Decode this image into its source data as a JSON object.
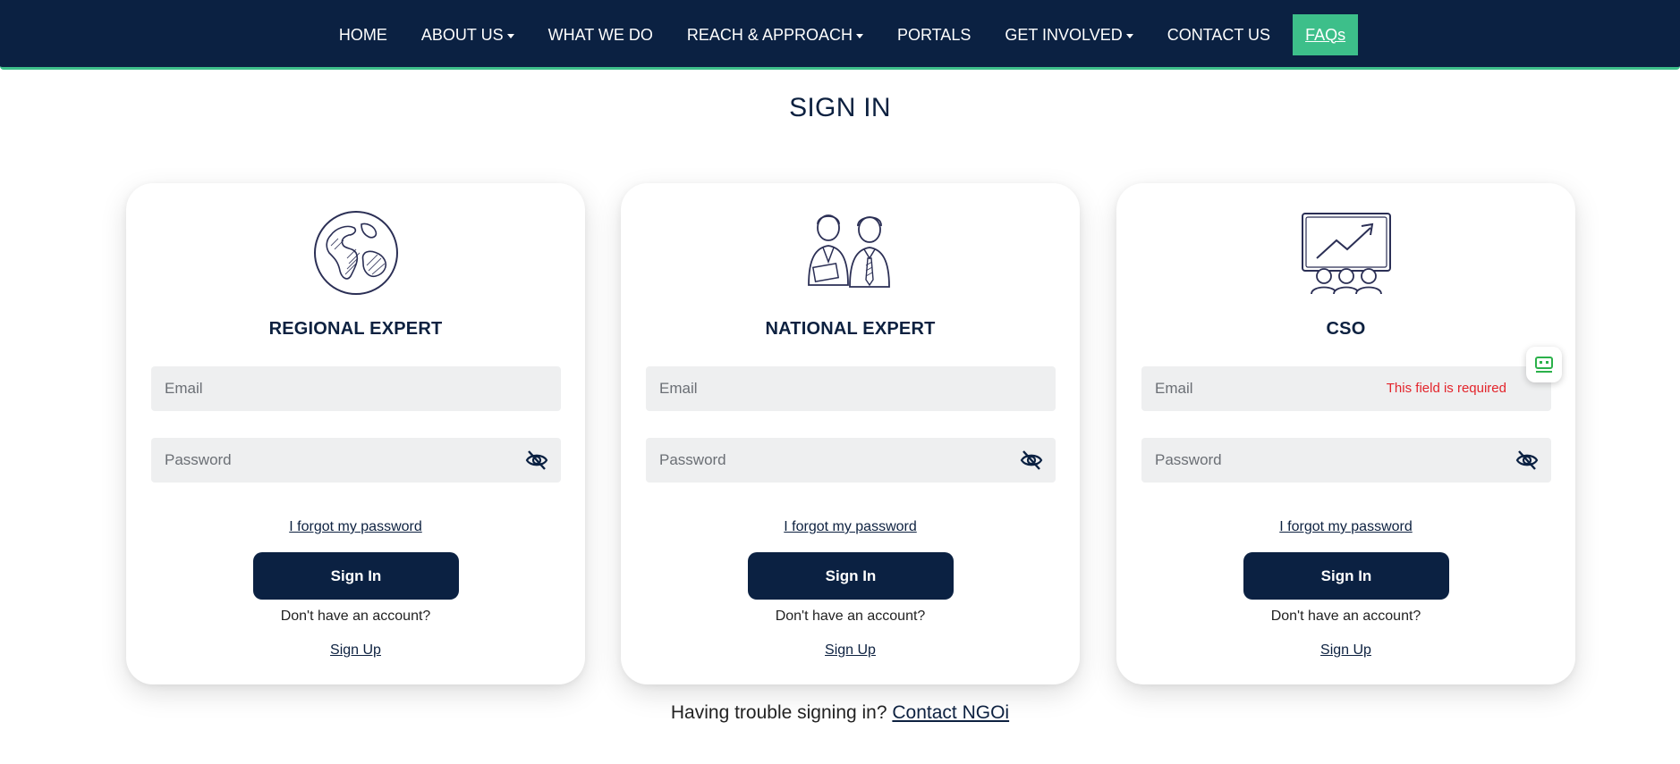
{
  "nav": {
    "items": [
      {
        "label": "HOME",
        "dropdown": false
      },
      {
        "label": "ABOUT US",
        "dropdown": true
      },
      {
        "label": "WHAT WE DO",
        "dropdown": false
      },
      {
        "label": "REACH & APPROACH",
        "dropdown": true
      },
      {
        "label": "PORTALS",
        "dropdown": false
      },
      {
        "label": "GET INVOLVED",
        "dropdown": true
      },
      {
        "label": "CONTACT US",
        "dropdown": false
      }
    ],
    "faq_label": "FAQs"
  },
  "page": {
    "title": "SIGN IN"
  },
  "cards": [
    {
      "title": "REGIONAL EXPERT",
      "icon": "globe-icon",
      "email_placeholder": "Email",
      "password_placeholder": "Password",
      "forgot": "I forgot my password",
      "signin": "Sign In",
      "no_account": "Don't have an account?",
      "signup": "Sign Up"
    },
    {
      "title": "NATIONAL EXPERT",
      "icon": "people-icon",
      "email_placeholder": "Email",
      "password_placeholder": "Password",
      "forgot": "I forgot my password",
      "signin": "Sign In",
      "no_account": "Don't have an account?",
      "signup": "Sign Up"
    },
    {
      "title": "CSO",
      "icon": "presentation-icon",
      "email_placeholder": "Email",
      "password_placeholder": "Password",
      "email_error": "This field is required",
      "forgot": "I forgot my password",
      "signin": "Sign In",
      "no_account": "Don't have an account?",
      "signup": "Sign Up"
    }
  ],
  "footer": {
    "trouble_text": "Having trouble signing in?",
    "contact_link": "Contact NGOi"
  },
  "colors": {
    "navy": "#0b2142",
    "accent": "#3dbf8a",
    "error": "#e3242b",
    "field_bg": "#eeeff0"
  }
}
